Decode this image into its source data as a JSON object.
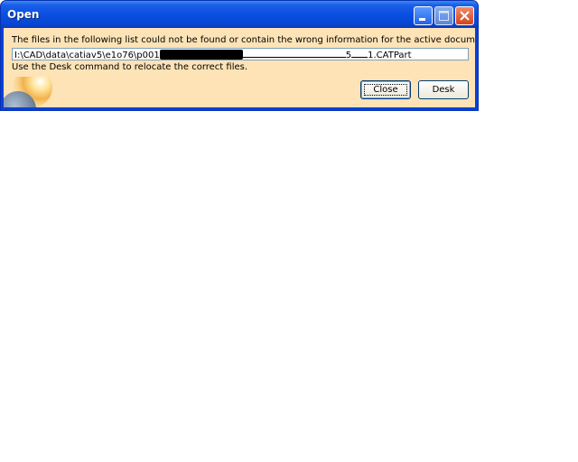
{
  "window": {
    "title": "Open"
  },
  "message": {
    "line1": "The files in the following list could not be found or contain the wrong information for the active document.",
    "path_prefix": "I:\\CAD\\data\\catiav5\\e1o76\\p001",
    "path_mid": "5",
    "path_suffix": "1.CATPart",
    "line2": "Use the Desk command to relocate the correct files."
  },
  "buttons": {
    "close_label": "Close",
    "desk_label": "Desk"
  },
  "icons": {
    "minimize": "minimize-icon",
    "maximize": "maximize-icon",
    "close": "close-icon",
    "logo": "globe-logo-icon"
  },
  "colors": {
    "titlebar": "#0a4fe0",
    "client_background": "#fde3b6",
    "close_button": "#d9421b"
  }
}
